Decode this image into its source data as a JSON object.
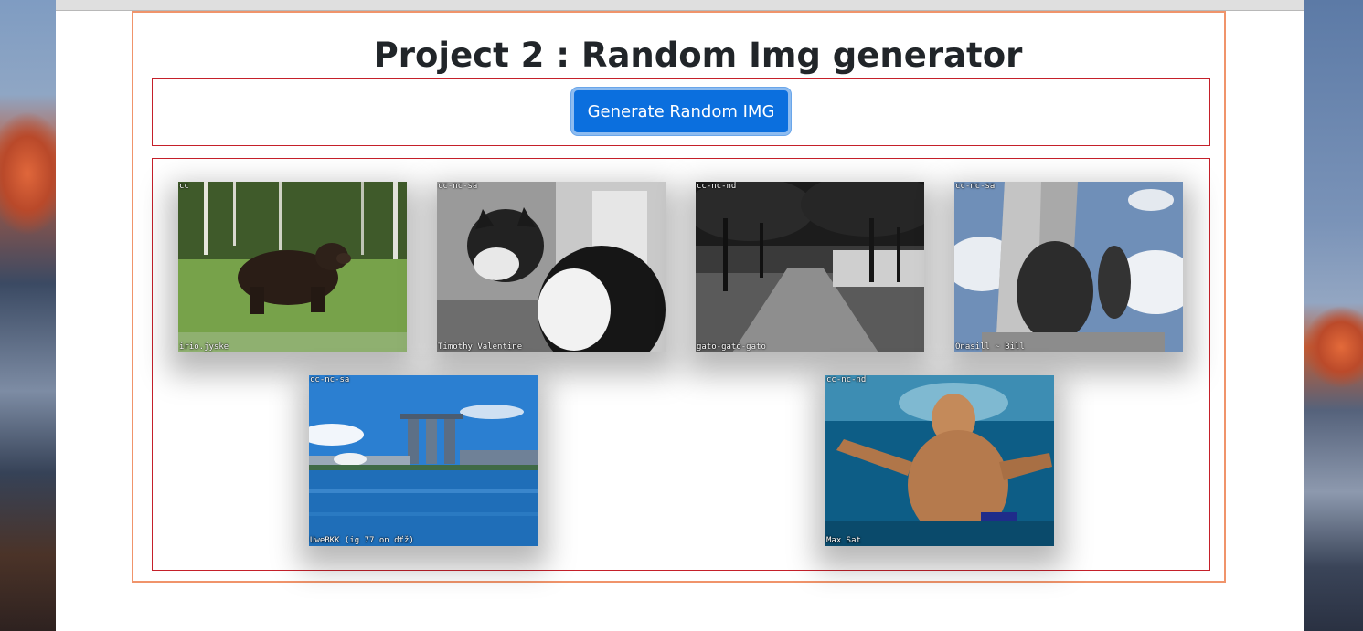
{
  "page": {
    "title": "Project 2 : Random Img generator",
    "generate_label": "Generate Random IMG"
  },
  "colors": {
    "outer_border": "#f0946b",
    "inner_border": "#c5202a",
    "button_bg": "#0b6fde",
    "button_ring": "#8ebcf0"
  },
  "images": [
    {
      "subject": "brown bear walking in grass",
      "license": "cc",
      "credit": "irio.jyske"
    },
    {
      "subject": "black and white cat",
      "license": "cc-nc-sa",
      "credit": "Timothy Valentine"
    },
    {
      "subject": "tree-lined park path in black and white",
      "license": "cc-nc-nd",
      "credit": "gato-gato-gato"
    },
    {
      "subject": "war memorial statue",
      "license": "cc-nc-sa",
      "credit": "Onasill ~ Bill"
    },
    {
      "subject": "Marina Bay Sands skyline over water",
      "license": "cc-nc-sa",
      "credit": "UweBKK (ig 77 on ďťž)"
    },
    {
      "subject": "boy swimming underwater",
      "license": "cc-nc-nd",
      "credit": "Max Sat"
    }
  ]
}
